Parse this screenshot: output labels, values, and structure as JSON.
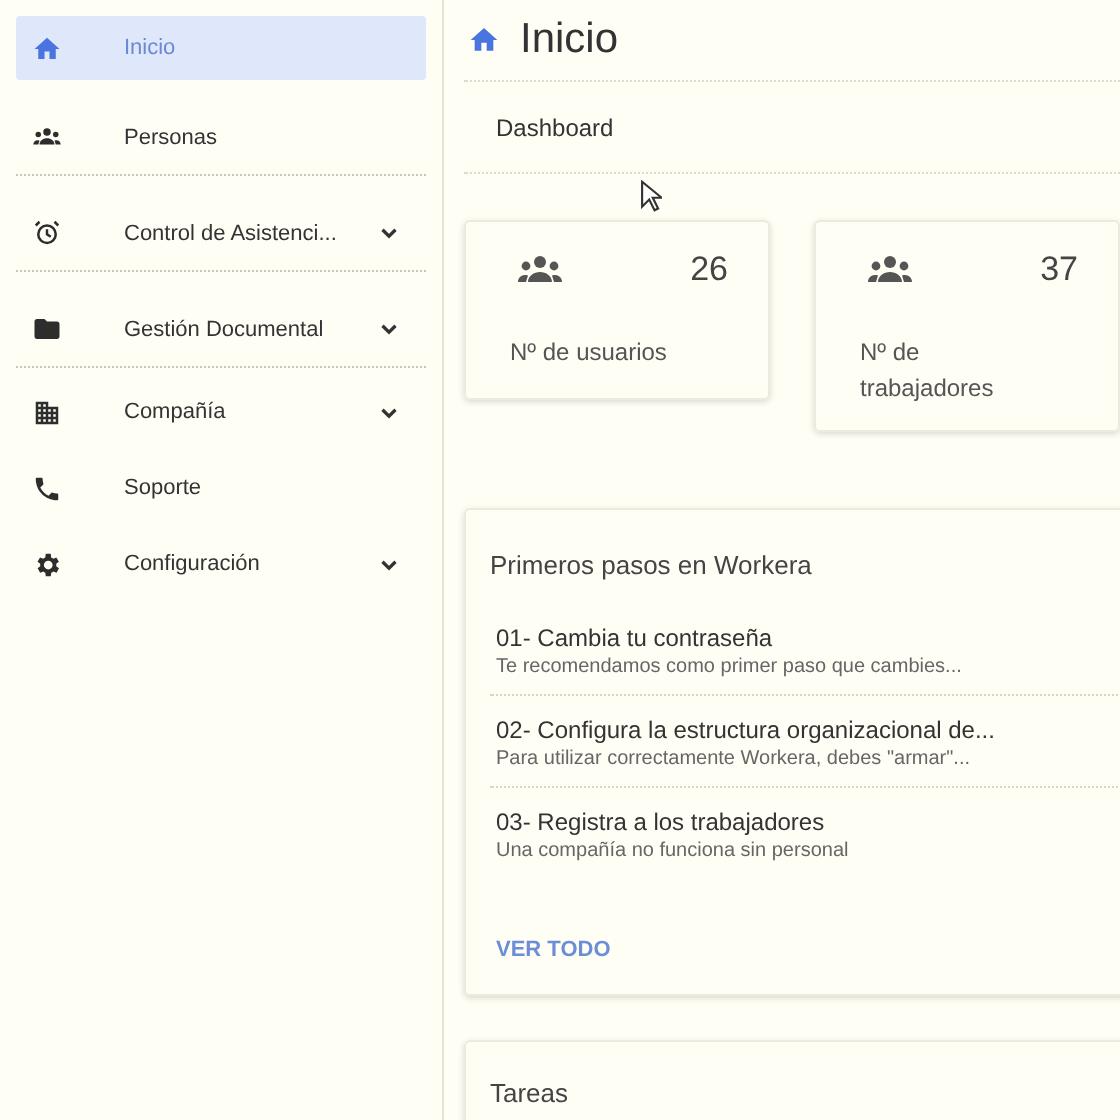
{
  "sidebar": {
    "items": [
      {
        "label": "Inicio",
        "kind": "home",
        "selected": true,
        "expandable": false,
        "divider": false
      },
      {
        "label": "Personas",
        "kind": "people",
        "selected": false,
        "expandable": false,
        "divider": true
      },
      {
        "label": "Control de Asistenci...",
        "kind": "alarm",
        "selected": false,
        "expandable": true,
        "divider": true
      },
      {
        "label": "Gestión Documental",
        "kind": "folder",
        "selected": false,
        "expandable": true,
        "divider": true
      },
      {
        "label": "Compañía",
        "kind": "building",
        "selected": false,
        "expandable": true,
        "divider": false
      },
      {
        "label": "Soporte",
        "kind": "phone",
        "selected": false,
        "expandable": false,
        "divider": false
      },
      {
        "label": "Configuración",
        "kind": "gear",
        "selected": false,
        "expandable": true,
        "divider": false
      }
    ]
  },
  "header": {
    "title": "Inicio"
  },
  "breadcrumb": "Dashboard",
  "stats": [
    {
      "value": "26",
      "label": "Nº de usuarios"
    },
    {
      "value": "37",
      "label": "Nº de trabajadores"
    }
  ],
  "steps_card": {
    "title": "Primeros pasos en Workera",
    "steps": [
      {
        "title": "01- Cambia tu contraseña",
        "description": "Te recomendamos como primer paso que cambies..."
      },
      {
        "title": "02- Configura la estructura organizacional de...",
        "description": "Para utilizar correctamente Workera, debes \"armar\"..."
      },
      {
        "title": "03- Registra a los trabajadores",
        "description": "Una compañía no funciona sin personal"
      }
    ],
    "link": "VER TODO"
  },
  "tasks_card": {
    "title": "Tareas"
  }
}
